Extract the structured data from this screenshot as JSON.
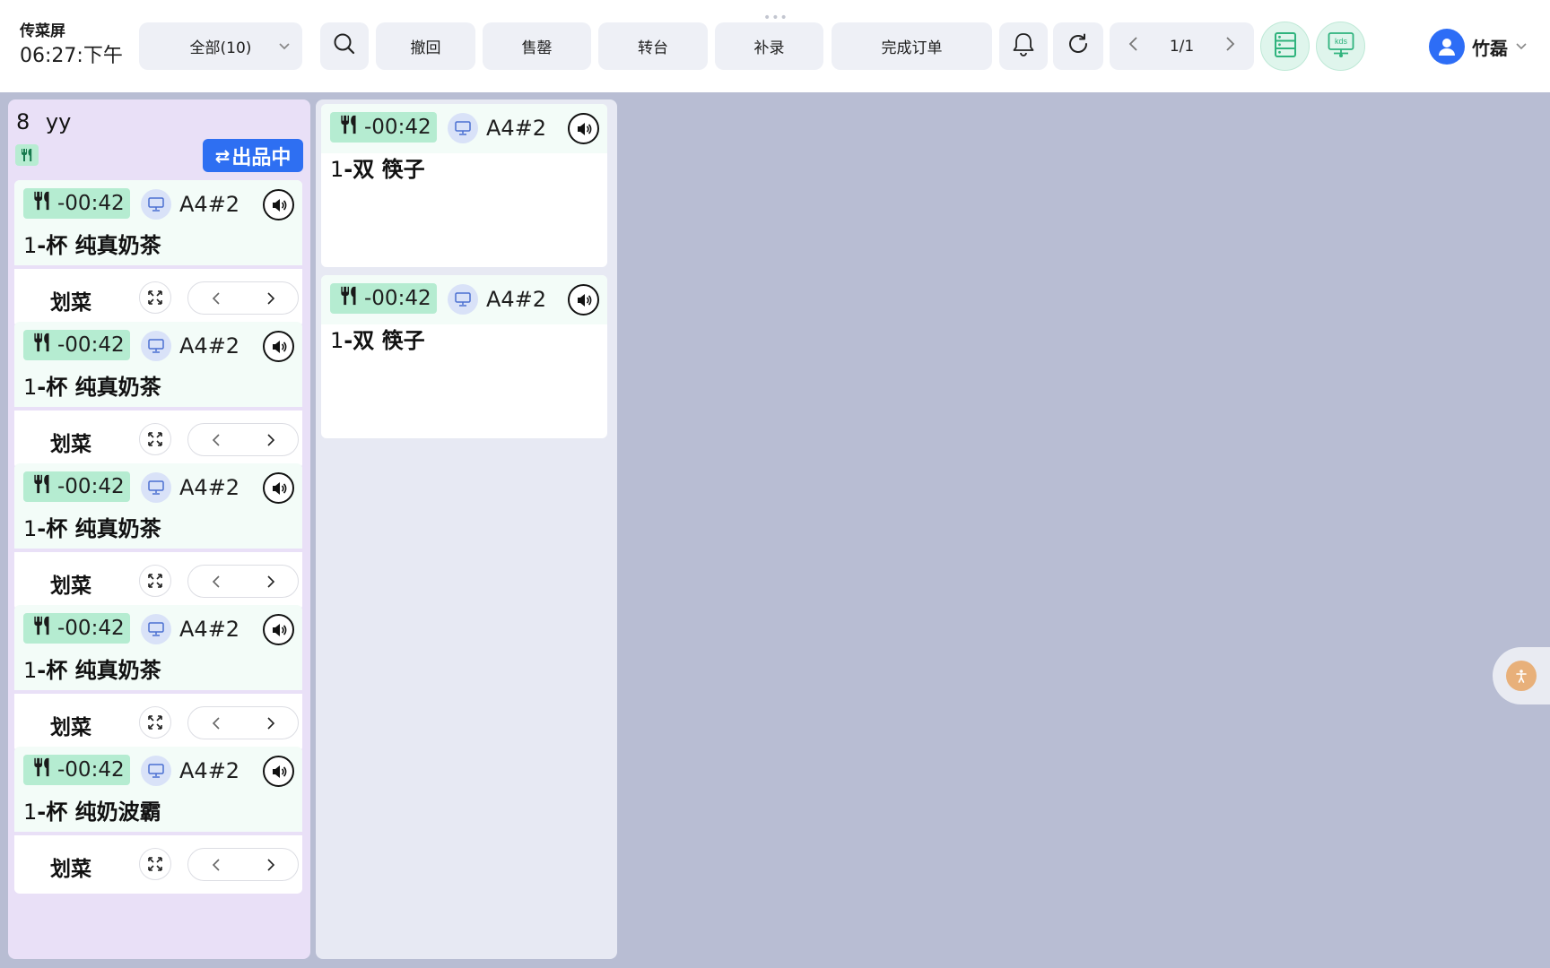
{
  "header": {
    "title": "传菜屏",
    "time": "06:27:下午",
    "filter_label": "全部(10)",
    "buttons": {
      "undo": "撤回",
      "soldout": "售罄",
      "transfer": "转台",
      "supplement": "补录",
      "finish": "完成订单"
    },
    "pager_text": "1/1",
    "user_name": "竹磊",
    "kds_label": "kds"
  },
  "order": {
    "number": "8",
    "name": "yy",
    "status": "出品中",
    "items": [
      {
        "timer": "-00:42",
        "table": "A4#2",
        "qty": "1",
        "unit": "-杯",
        "name": "纯真奶茶",
        "mark": "划菜"
      },
      {
        "timer": "-00:42",
        "table": "A4#2",
        "qty": "1",
        "unit": "-杯",
        "name": "纯真奶茶",
        "mark": "划菜"
      },
      {
        "timer": "-00:42",
        "table": "A4#2",
        "qty": "1",
        "unit": "-杯",
        "name": "纯真奶茶",
        "mark": "划菜"
      },
      {
        "timer": "-00:42",
        "table": "A4#2",
        "qty": "1",
        "unit": "-杯",
        "name": "纯真奶茶",
        "mark": "划菜"
      },
      {
        "timer": "-00:42",
        "table": "A4#2",
        "qty": "1",
        "unit": "-杯",
        "name": "纯奶波霸",
        "mark": "划菜"
      }
    ]
  },
  "column2": {
    "items": [
      {
        "timer": "-00:42",
        "table": "A4#2",
        "qty": "1",
        "unit": "-双",
        "name": "筷子"
      },
      {
        "timer": "-00:42",
        "table": "A4#2",
        "qty": "1",
        "unit": "-双",
        "name": "筷子"
      }
    ]
  },
  "colors": {
    "accent": "#2e6ff2",
    "timer_bg": "#b5ecd1",
    "order_bg": "#e9e0f7",
    "canvas_bg": "#b8bdd3"
  },
  "icons": {
    "search": "search-icon",
    "bell": "bell-icon",
    "refresh": "refresh-icon",
    "layout": "server-list-icon",
    "kds": "kds-monitor-icon",
    "fork": "fork-knife-icon",
    "pos": "pos-terminal-icon",
    "speaker": "speaker-icon",
    "expand": "expand-icon"
  }
}
